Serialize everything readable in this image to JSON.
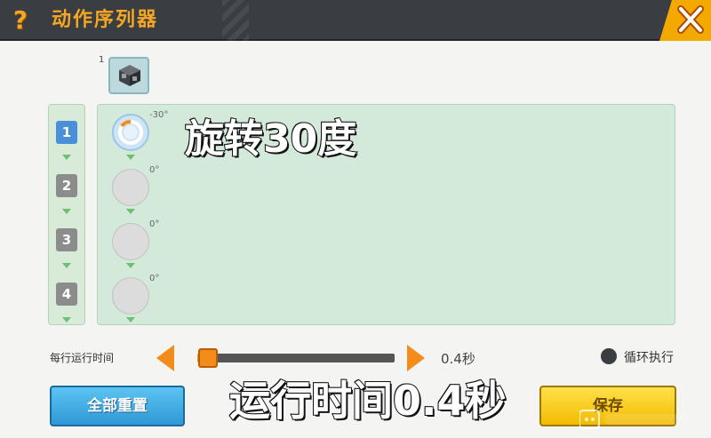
{
  "header": {
    "help_glyph": "?",
    "title": "动作序列器",
    "close_icon": "close-x-icon"
  },
  "block_slot": {
    "index": "1",
    "icon": "cube-block-icon"
  },
  "steps": [
    {
      "label": "1",
      "active": true
    },
    {
      "label": "2",
      "active": false
    },
    {
      "label": "3",
      "active": false
    },
    {
      "label": "4",
      "active": false
    }
  ],
  "actions": [
    {
      "angle": "-30°",
      "active": true
    },
    {
      "angle": "0°",
      "active": false
    },
    {
      "angle": "0°",
      "active": false
    },
    {
      "angle": "0°",
      "active": false
    }
  ],
  "captions": {
    "rotate": "旋转30度",
    "time": "运行时间0.4秒"
  },
  "controls": {
    "time_label": "每行运行时间",
    "time_value": "0.4秒",
    "slider_fraction": 0.04,
    "loop_label": "循环执行"
  },
  "buttons": {
    "reset": "全部重置",
    "save": "保存"
  },
  "colors": {
    "accent_orange": "#f28c1a",
    "header_bg": "#3a3d42",
    "title_color": "#f5a623",
    "active_step": "#4a90d9"
  }
}
